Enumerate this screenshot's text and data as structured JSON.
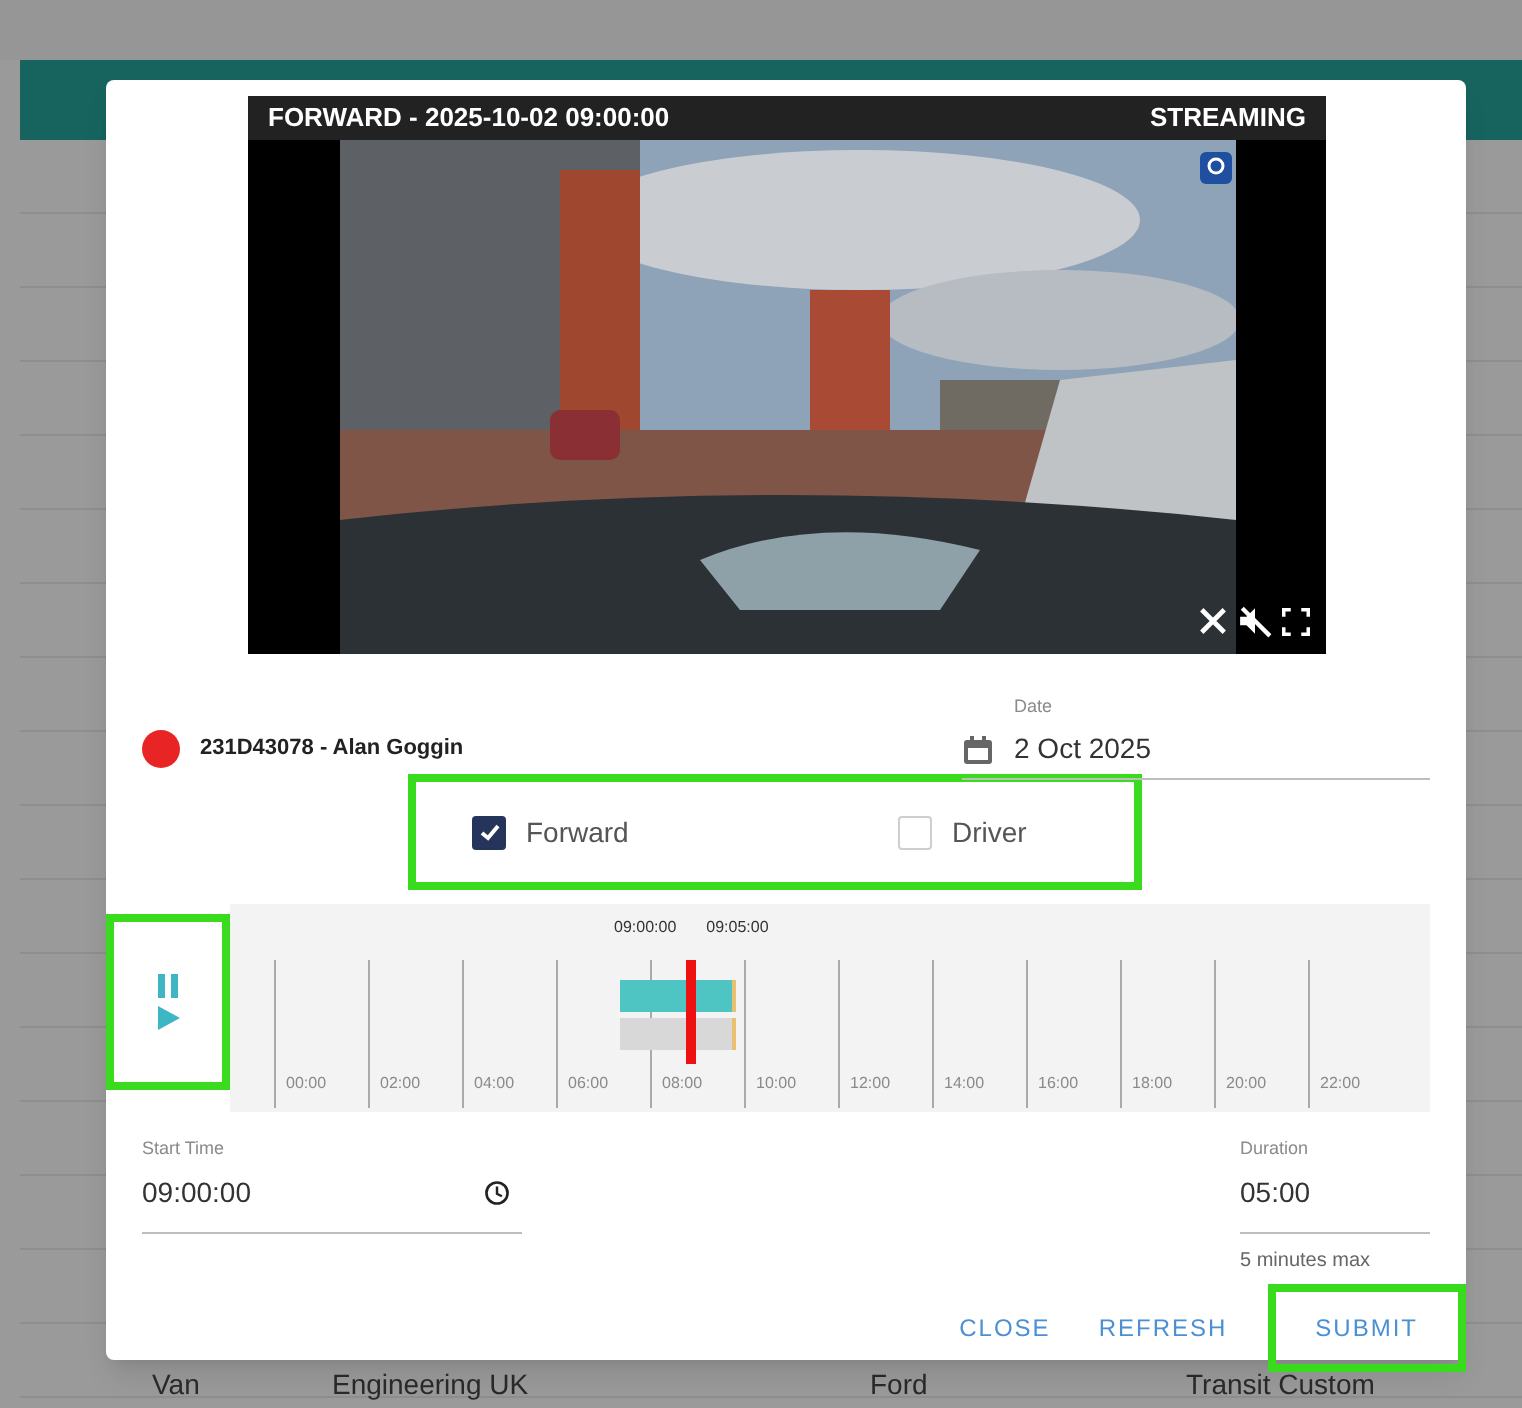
{
  "video": {
    "title": "FORWARD - 2025-10-02 09:00:00",
    "status": "STREAMING",
    "muted": true
  },
  "vehicle": {
    "label": "231D43078 - Alan Goggin",
    "color": "#e82424"
  },
  "date": {
    "label": "Date",
    "value": "2 Oct 2025"
  },
  "channels": [
    {
      "label": "Forward",
      "checked": true
    },
    {
      "label": "Driver",
      "checked": false
    }
  ],
  "timeline": {
    "playing": true,
    "range_labels": [
      "09:00:00",
      "09:05:00"
    ],
    "hours": [
      "00:00",
      "02:00",
      "04:00",
      "06:00",
      "08:00",
      "10:00",
      "12:00",
      "14:00",
      "16:00",
      "18:00",
      "20:00",
      "22:00"
    ]
  },
  "start_time": {
    "label": "Start Time",
    "value": "09:00:00"
  },
  "duration": {
    "label": "Duration",
    "value": "05:00",
    "hint": "5 minutes max"
  },
  "buttons": [
    "CLOSE",
    "REFRESH",
    "SUBMIT"
  ],
  "background_row": [
    "Van",
    "Engineering UK",
    "Ford",
    "Transit Custom"
  ]
}
